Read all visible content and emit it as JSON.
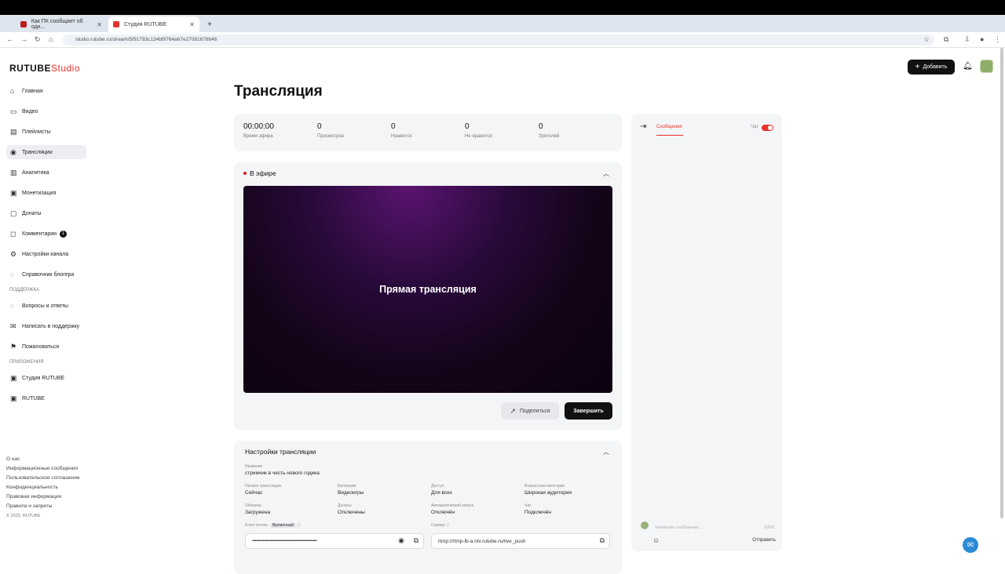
{
  "browser": {
    "tabs": [
      {
        "title": "Как ПК сообщает об одн..."
      },
      {
        "title": "Студия RUTUBE"
      }
    ],
    "url": "studio.rutube.ru/stream/5f91793c134bf9764a67e27081678b46"
  },
  "header": {
    "logo_main": "RUTUBE",
    "logo_studio": "Studio",
    "add_button": "Добавить"
  },
  "sidebar": {
    "items": [
      {
        "label": "Главная",
        "icon": "home-icon"
      },
      {
        "label": "Видео",
        "icon": "video-icon"
      },
      {
        "label": "Плейлисты",
        "icon": "playlist-icon"
      },
      {
        "label": "Трансляции",
        "icon": "broadcast-icon"
      },
      {
        "label": "Аналитика",
        "icon": "analytics-icon"
      },
      {
        "label": "Монетизация",
        "icon": "money-icon"
      },
      {
        "label": "Донаты",
        "icon": "donate-icon"
      },
      {
        "label": "Комментарии",
        "icon": "comment-icon",
        "badge": "1"
      },
      {
        "label": "Настройки канала",
        "icon": "gear-icon"
      },
      {
        "label": "Справочник блогера",
        "icon": "help-circle-icon"
      }
    ],
    "support_title": "ПОДДЕРЖКА",
    "support_items": [
      {
        "label": "Вопросы и ответы"
      },
      {
        "label": "Написать в поддержку"
      },
      {
        "label": "Пожаловаться"
      }
    ],
    "apps_title": "ПРИЛОЖЕНИЯ",
    "apps_items": [
      {
        "label": "Студия RUTUBE"
      },
      {
        "label": "RUTUBE"
      }
    ],
    "footer_links": [
      "О нас",
      "Информационные сообщения",
      "Пользовательское соглашение",
      "Конфиденциальность",
      "Правовая информация",
      "Правила и запреты"
    ],
    "copyright": "© 2025, RUTUBE"
  },
  "main": {
    "title": "Трансляция",
    "stats": [
      {
        "value": "00:00:00",
        "label": "Время эфира"
      },
      {
        "value": "0",
        "label": "Просмотров"
      },
      {
        "value": "0",
        "label": "Нравится"
      },
      {
        "value": "0",
        "label": "Не нравится"
      },
      {
        "value": "0",
        "label": "Зрителей"
      }
    ],
    "live": {
      "status": "В эфире",
      "player_text": "Прямая трансляция",
      "share": "Поделиться",
      "finish": "Завершить"
    },
    "settings": {
      "title": "Настройки трансляции",
      "name_label": "Название",
      "name_value": "стримчик в честь нового годика",
      "fields": [
        {
          "label": "Начало трансляции",
          "value": "Сейчас"
        },
        {
          "label": "Категория",
          "value": "Видеоигры"
        },
        {
          "label": "Доступ",
          "value": "Для всех"
        },
        {
          "label": "Возрастная категория",
          "value": "Широкая аудитория"
        },
        {
          "label": "Обложка",
          "value": "Загружена"
        },
        {
          "label": "Донаты",
          "value": "Отключены"
        },
        {
          "label": "Автоматический запуск",
          "value": "Отключён"
        },
        {
          "label": "Чат",
          "value": "Подключён"
        }
      ],
      "key_label": "Ключ потока",
      "key_tag": "Временный",
      "key_value": "••••••••••••••••••••••••••••••••••••••••••••••••••••••••••••••••••",
      "server_label": "Сервер",
      "server_value": "rtmp://rtmp-lb-a.ntv.rutube.ru/live_push"
    }
  },
  "chat": {
    "tab": "Сообщения",
    "toggle_label": "Чат",
    "input_placeholder": "Написать сообщение...",
    "counter": "0/200",
    "send": "Отправить"
  }
}
